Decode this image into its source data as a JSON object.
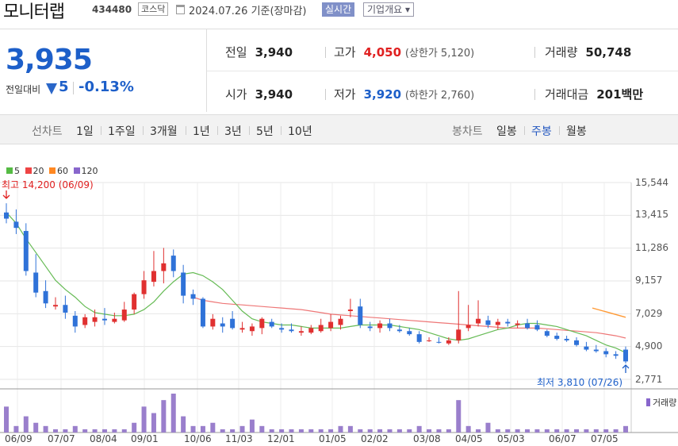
{
  "header": {
    "name": "모니터랩",
    "code": "434480",
    "market": "코스닥",
    "date": "2024.07.26 기준(장마감)",
    "realtime": "실시간",
    "company": "기업개요 ▾"
  },
  "price": {
    "current": "3,935",
    "diff_label": "전일대비",
    "diff": "5",
    "rate": "-0.13%"
  },
  "stats": {
    "prev_label": "전일",
    "prev": "3,940",
    "high_label": "고가",
    "high": "4,050",
    "upper": "(상한가 5,120)",
    "volume_label": "거래량",
    "volume": "50,748",
    "open_label": "시가",
    "open": "3,940",
    "low_label": "저가",
    "low": "3,920",
    "lower": "(하한가 2,760)",
    "amount_label": "거래대금",
    "amount": "201",
    "amount_unit": "백만"
  },
  "tabs": {
    "line_label": "선차트",
    "line": [
      "1일",
      "1주일",
      "3개월",
      "1년",
      "3년",
      "5년",
      "10년"
    ],
    "candle_label": "봉차트",
    "candle": [
      "일봉",
      "주봉",
      "월봉"
    ],
    "active_candle": "주봉"
  },
  "chart_data": {
    "type": "candlestick",
    "legend": [
      "5",
      "20",
      "60",
      "120"
    ],
    "legend_colors": [
      "#55bb44",
      "#ee4444",
      "#ff8822",
      "#8866cc"
    ],
    "max_label": "최고 14,200 (06/09)",
    "min_label": "최저 3,810 (07/26)",
    "yticks": [
      "15,544",
      "13,415",
      "11,286",
      "9,157",
      "7,029",
      "4,900",
      "2,771"
    ],
    "xticks": [
      "06/09",
      "07/07",
      "08/04",
      "09/01",
      "10/06",
      "11/03",
      "12/01",
      "01/05",
      "02/02",
      "03/08",
      "04/05",
      "05/03",
      "06/07",
      "07/05"
    ],
    "ylim": [
      2771,
      15544
    ],
    "volume_label": "거래량",
    "candles": [
      [
        13600,
        14200,
        12900,
        13200
      ],
      [
        13000,
        13800,
        12200,
        12600
      ],
      [
        12400,
        12900,
        9500,
        9800
      ],
      [
        9700,
        10900,
        8100,
        8400
      ],
      [
        8500,
        9200,
        7400,
        7700
      ],
      [
        7500,
        8100,
        7300,
        7600
      ],
      [
        7600,
        8200,
        6700,
        7100
      ],
      [
        6900,
        7200,
        5800,
        6200
      ],
      [
        6300,
        7000,
        6100,
        6800
      ],
      [
        6500,
        7300,
        6200,
        6800
      ],
      [
        6700,
        7400,
        6300,
        6600
      ],
      [
        6500,
        7100,
        6400,
        6700
      ],
      [
        6600,
        7800,
        6500,
        7300
      ],
      [
        7300,
        8400,
        7000,
        8300
      ],
      [
        8300,
        9800,
        8000,
        9200
      ],
      [
        9100,
        11100,
        8800,
        9800
      ],
      [
        9800,
        11300,
        9000,
        10300
      ],
      [
        10800,
        11200,
        9400,
        9800
      ],
      [
        9700,
        10200,
        7700,
        8200
      ],
      [
        8300,
        8600,
        7600,
        8000
      ],
      [
        8000,
        8100,
        6100,
        6200
      ],
      [
        6200,
        7000,
        6000,
        6700
      ],
      [
        6400,
        6800,
        5800,
        6200
      ],
      [
        6700,
        7200,
        6000,
        6100
      ],
      [
        6000,
        6500,
        5800,
        6100
      ],
      [
        5900,
        6400,
        5600,
        6200
      ],
      [
        6100,
        6800,
        5700,
        6700
      ],
      [
        6500,
        6700,
        6100,
        6200
      ],
      [
        6100,
        6400,
        5800,
        6000
      ],
      [
        6000,
        6400,
        5800,
        5900
      ],
      [
        5800,
        6200,
        5600,
        5900
      ],
      [
        5800,
        6300,
        5700,
        6100
      ],
      [
        5900,
        6700,
        5800,
        6300
      ],
      [
        6100,
        7000,
        5900,
        6500
      ],
      [
        6300,
        6900,
        6000,
        6700
      ],
      [
        7200,
        8000,
        6800,
        7300
      ],
      [
        7500,
        8000,
        6100,
        6300
      ],
      [
        6200,
        6500,
        5900,
        6100
      ],
      [
        6100,
        6600,
        5800,
        6400
      ],
      [
        6400,
        6700,
        5900,
        6100
      ],
      [
        6000,
        6300,
        5800,
        5900
      ],
      [
        5900,
        6100,
        5600,
        5700
      ],
      [
        5700,
        5900,
        5100,
        5200
      ],
      [
        5300,
        5500,
        5200,
        5300
      ],
      [
        5200,
        5500,
        5100,
        5150
      ],
      [
        5100,
        5500,
        5000,
        5300
      ],
      [
        5300,
        8500,
        5100,
        6000
      ],
      [
        6100,
        7600,
        5900,
        6300
      ],
      [
        6400,
        7900,
        6200,
        6700
      ],
      [
        6600,
        6900,
        6100,
        6300
      ],
      [
        6300,
        6700,
        6000,
        6500
      ],
      [
        6500,
        6700,
        6200,
        6400
      ],
      [
        6300,
        6600,
        6100,
        6400
      ],
      [
        6400,
        6700,
        6000,
        6100
      ],
      [
        6300,
        6600,
        5900,
        6000
      ],
      [
        5900,
        6000,
        5500,
        5600
      ],
      [
        5600,
        5800,
        5300,
        5400
      ],
      [
        5400,
        5600,
        5200,
        5300
      ],
      [
        5300,
        5500,
        4900,
        5000
      ],
      [
        4900,
        5200,
        4600,
        4700
      ],
      [
        4700,
        5000,
        4500,
        4600
      ],
      [
        4600,
        4800,
        4200,
        4400
      ],
      [
        4400,
        4600,
        4100,
        4300
      ],
      [
        4700,
        4900,
        3810,
        3935
      ]
    ],
    "ma5": [
      13600,
      12900,
      11900,
      11000,
      10100,
      9200,
      8600,
      8100,
      7500,
      7100,
      7000,
      6900,
      6900,
      7000,
      7300,
      7800,
      8500,
      9100,
      9600,
      9700,
      9500,
      9100,
      8600,
      7900,
      7200,
      6700,
      6500,
      6400,
      6300,
      6300,
      6200,
      6100,
      6100,
      6100,
      6100,
      6200,
      6300,
      6300,
      6300,
      6300,
      6200,
      6100,
      6000,
      5800,
      5600,
      5400,
      5300,
      5400,
      5600,
      5800,
      6000,
      6100,
      6300,
      6400,
      6400,
      6300,
      6200,
      6000,
      5800,
      5600,
      5300,
      5000,
      4800,
      4500
    ],
    "ma20": [
      null,
      null,
      null,
      null,
      null,
      null,
      null,
      null,
      null,
      null,
      null,
      null,
      null,
      null,
      null,
      null,
      null,
      null,
      null,
      8100,
      7900,
      7800,
      7700,
      7650,
      7600,
      7550,
      7500,
      7450,
      7400,
      7350,
      7300,
      7200,
      7100,
      7000,
      6950,
      6900,
      6850,
      6800,
      6750,
      6700,
      6650,
      6600,
      6550,
      6500,
      6450,
      6400,
      6350,
      6300,
      6250,
      6200,
      6150,
      6100,
      6100,
      6100,
      6100,
      6050,
      6000,
      5950,
      5900,
      5850,
      5800,
      5700,
      5600,
      5450
    ],
    "ma60": [
      7400,
      6800
    ],
    "volume": [
      8,
      2,
      5,
      3,
      2,
      1,
      1,
      2,
      1,
      1,
      1,
      1,
      1,
      3,
      8,
      6,
      10,
      12,
      5,
      2,
      2,
      3,
      1,
      1,
      2,
      4,
      2,
      1,
      1,
      1,
      1,
      1,
      1,
      1,
      2,
      2,
      1,
      1,
      1,
      1,
      1,
      1,
      2,
      1,
      1,
      1,
      10,
      2,
      1,
      3,
      1,
      1,
      1,
      1,
      1,
      1,
      1,
      1,
      1,
      1,
      1,
      1,
      1,
      2
    ]
  }
}
